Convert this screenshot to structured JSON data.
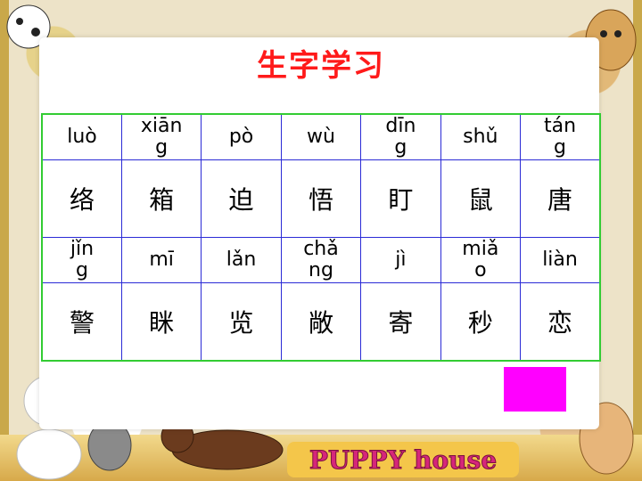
{
  "slide": {
    "title": "生字学习",
    "accent_color": "#ff1a1a",
    "grid_border_color": "#2b2bd6",
    "table_outline_color": "#33cc33",
    "marker_color": "#ff00ff",
    "decor_logo": "PUPPY house"
  },
  "rows": [
    {
      "pinyin": [
        "luò",
        "xiān g",
        "pò",
        "wù",
        "dīn g",
        "shǔ",
        "tán g"
      ],
      "hanzi": [
        "络",
        "箱",
        "迫",
        "悟",
        "盯",
        "鼠",
        "唐"
      ]
    },
    {
      "pinyin": [
        "jǐn g",
        "mī",
        "lǎn",
        "chǎ ng",
        "jì",
        "miǎ o",
        "liàn"
      ],
      "hanzi": [
        "警",
        "眯",
        "览",
        "敞",
        "寄",
        "秒",
        "恋"
      ]
    }
  ]
}
